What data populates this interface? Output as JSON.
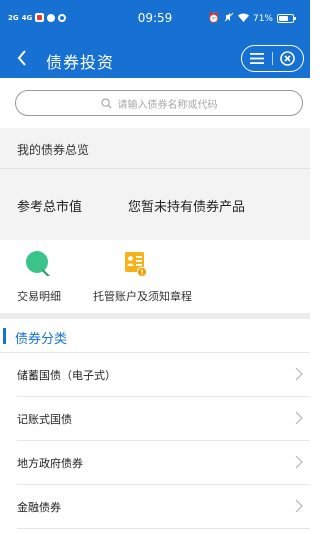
{
  "status_bar": {
    "signal_1": "2G",
    "signal_2": "4G",
    "time": "09:59",
    "battery": "71%",
    "battery_level": 0.71
  },
  "nav": {
    "title": "债券投资"
  },
  "search": {
    "placeholder": "请输入债券名称或代码"
  },
  "overview": {
    "title": "我的债券总览",
    "market_value_label": "参考总市值",
    "market_value_text": "您暂未持有债券产品"
  },
  "shortcuts": [
    {
      "label": "交易明细",
      "icon": "search-magnifier-icon",
      "color": "#3bc48a"
    },
    {
      "label": "托管账户及须知章程",
      "icon": "account-card-icon",
      "color": "#f5b21a"
    }
  ],
  "category": {
    "title": "债券分类",
    "items": [
      {
        "label": "储蓄国债（电子式）"
      },
      {
        "label": "记账式国债"
      },
      {
        "label": "地方政府债券"
      },
      {
        "label": "金融债券"
      }
    ]
  },
  "colors": {
    "brand": "#1771d2",
    "green": "#3bc48a",
    "orange": "#f5b21a"
  }
}
